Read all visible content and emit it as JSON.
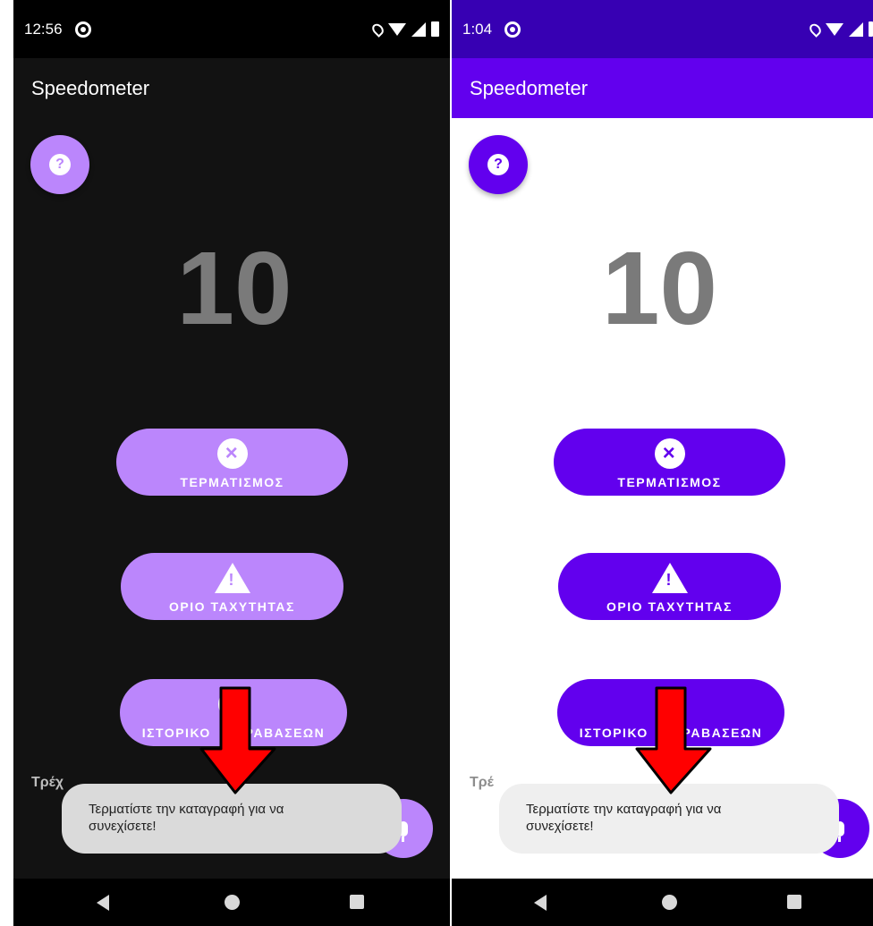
{
  "screens": [
    {
      "theme": "dark",
      "status_time": "12:56",
      "app_title": "Speedometer",
      "speed_value": "10",
      "buttons": {
        "stop_label": "ΤΕΡΜΑΤΙΣΜΟΣ",
        "speed_limit_label": "ΟΡΙΟ ΤΑΧΥΤΗΤΑΣ",
        "history_label_left": "ΙΣΤΟΡΙΚΟ",
        "history_label_right": "ΡΑΒΑΣΕΩΝ"
      },
      "current_label": "Τρέχ",
      "toast_text_line1": "Τερματίστε την καταγραφή για να",
      "toast_text_line2": "συνεχίσετε!"
    },
    {
      "theme": "light",
      "status_time": "1:04",
      "app_title": "Speedometer",
      "speed_value": "10",
      "buttons": {
        "stop_label": "ΤΕΡΜΑΤΙΣΜΟΣ",
        "speed_limit_label": "ΟΡΙΟ ΤΑΧΥΤΗΤΑΣ",
        "history_label_left": "ΙΣΤΟΡΙΚΟ",
        "history_label_right": "ΡΑΒΑΣΕΩΝ"
      },
      "current_label": "Τρέ",
      "toast_text_line1": "Τερματίστε την καταγραφή για να",
      "toast_text_line2": "συνεχίσετε!"
    }
  ],
  "colors": {
    "dark_primary": "#bb86fc",
    "light_primary": "#6200ee",
    "light_status_bar": "#3700b3",
    "dark_background": "#121212",
    "annotation_arrow": "#ff0000"
  },
  "icons": [
    "dnd-icon",
    "location-icon",
    "wifi-icon",
    "signal-icon",
    "battery-icon",
    "help-icon",
    "close-circle-icon",
    "warning-icon",
    "history-icon",
    "mic-icon",
    "nav-back-icon",
    "nav-home-icon",
    "nav-recents-icon",
    "red-arrow-annotation"
  ]
}
